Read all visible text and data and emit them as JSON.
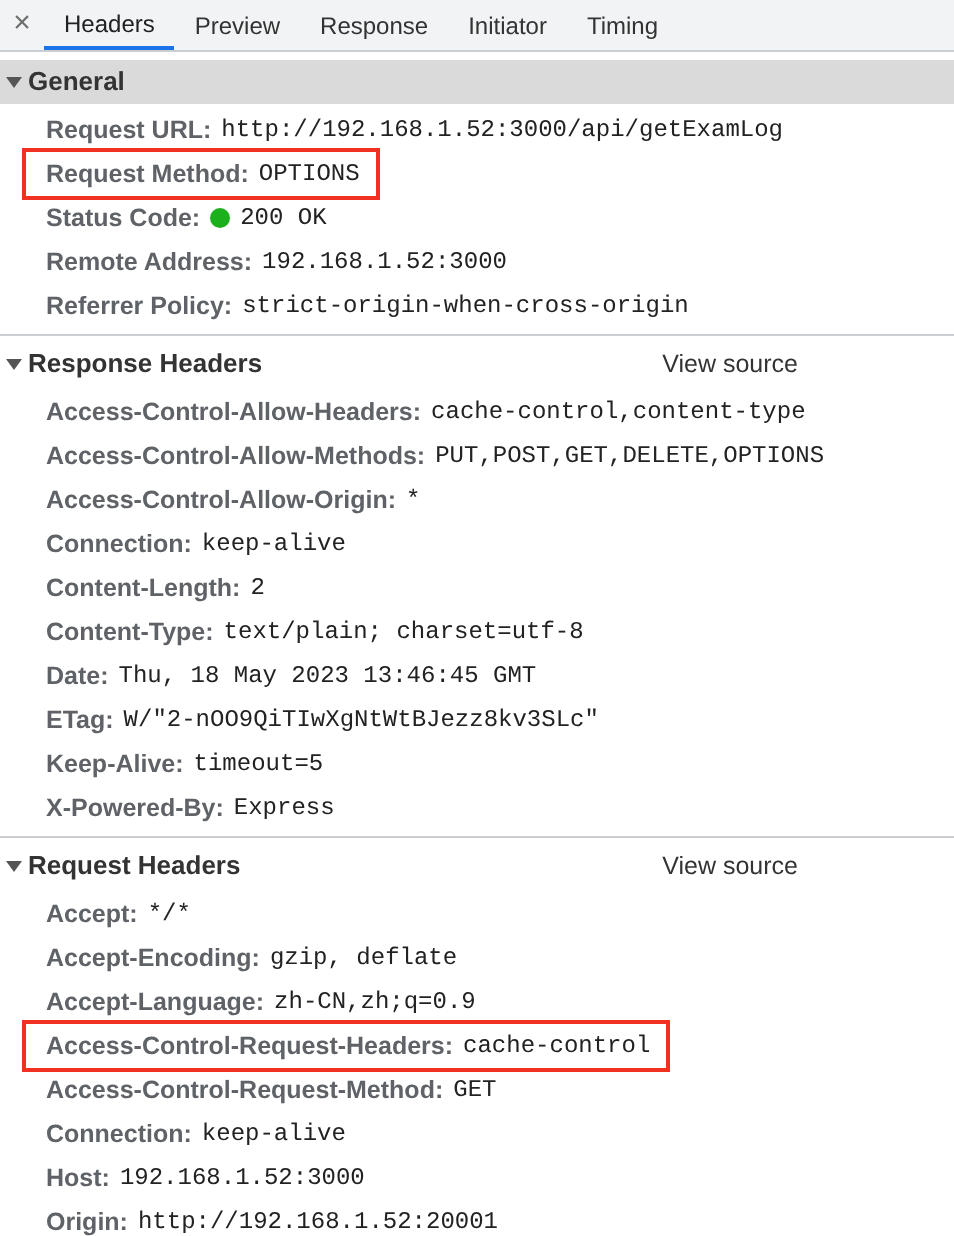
{
  "close_label": "×",
  "tabs": [
    {
      "label": "Headers",
      "selected": true
    },
    {
      "label": "Preview",
      "selected": false
    },
    {
      "label": "Response",
      "selected": false
    },
    {
      "label": "Initiator",
      "selected": false
    },
    {
      "label": "Timing",
      "selected": false
    }
  ],
  "sections": [
    {
      "title": "General",
      "expanded": true,
      "shaded": true,
      "rows": [
        {
          "name": "Request URL:",
          "value": "http://192.168.1.52:3000/api/getExamLog",
          "highlighted": false
        },
        {
          "name": "Request Method:",
          "value": "OPTIONS",
          "highlighted": true
        },
        {
          "name": "Status Code:",
          "value": "200 OK",
          "highlighted": false,
          "color": "#1db01d"
        },
        {
          "name": "Remote Address:",
          "value": "192.168.1.52:3000",
          "highlighted": false
        },
        {
          "name": "Referrer Policy:",
          "value": "strict-origin-when-cross-origin",
          "highlighted": false
        }
      ]
    },
    {
      "title": "Response Headers",
      "expanded": true,
      "shaded": false,
      "link": "View source",
      "rows": [
        {
          "name": "Access-Control-Allow-Headers:",
          "value": "cache-control,content-type",
          "highlighted": false
        },
        {
          "name": "Access-Control-Allow-Methods:",
          "value": "PUT,POST,GET,DELETE,OPTIONS",
          "highlighted": false
        },
        {
          "name": "Access-Control-Allow-Origin:",
          "value": "*",
          "highlighted": false
        },
        {
          "name": "Connection:",
          "value": "keep-alive",
          "highlighted": false
        },
        {
          "name": "Content-Length:",
          "value": "2",
          "highlighted": false
        },
        {
          "name": "Content-Type:",
          "value": "text/plain; charset=utf-8",
          "highlighted": false
        },
        {
          "name": "Date:",
          "value": "Thu, 18 May 2023 13:46:45 GMT",
          "highlighted": false
        },
        {
          "name": "ETag:",
          "value": "W/\"2-nOO9QiTIwXgNtWtBJezz8kv3SLc\"",
          "highlighted": false
        },
        {
          "name": "Keep-Alive:",
          "value": "timeout=5",
          "highlighted": false
        },
        {
          "name": "X-Powered-By:",
          "value": "Express",
          "highlighted": false
        }
      ]
    },
    {
      "title": "Request Headers",
      "expanded": true,
      "shaded": false,
      "link": "View source",
      "rows": [
        {
          "name": "Accept:",
          "value": "*/*",
          "highlighted": false
        },
        {
          "name": "Accept-Encoding:",
          "value": "gzip, deflate",
          "highlighted": false
        },
        {
          "name": "Accept-Language:",
          "value": "zh-CN,zh;q=0.9",
          "highlighted": false
        },
        {
          "name": "Access-Control-Request-Headers:",
          "value": "cache-control",
          "highlighted": true
        },
        {
          "name": "Access-Control-Request-Method:",
          "value": "GET",
          "highlighted": false
        },
        {
          "name": "Connection:",
          "value": "keep-alive",
          "highlighted": false
        },
        {
          "name": "Host:",
          "value": "192.168.1.52:3000",
          "highlighted": false
        },
        {
          "name": "Origin:",
          "value": "http://192.168.1.52:20001",
          "highlighted": false
        }
      ]
    }
  ]
}
